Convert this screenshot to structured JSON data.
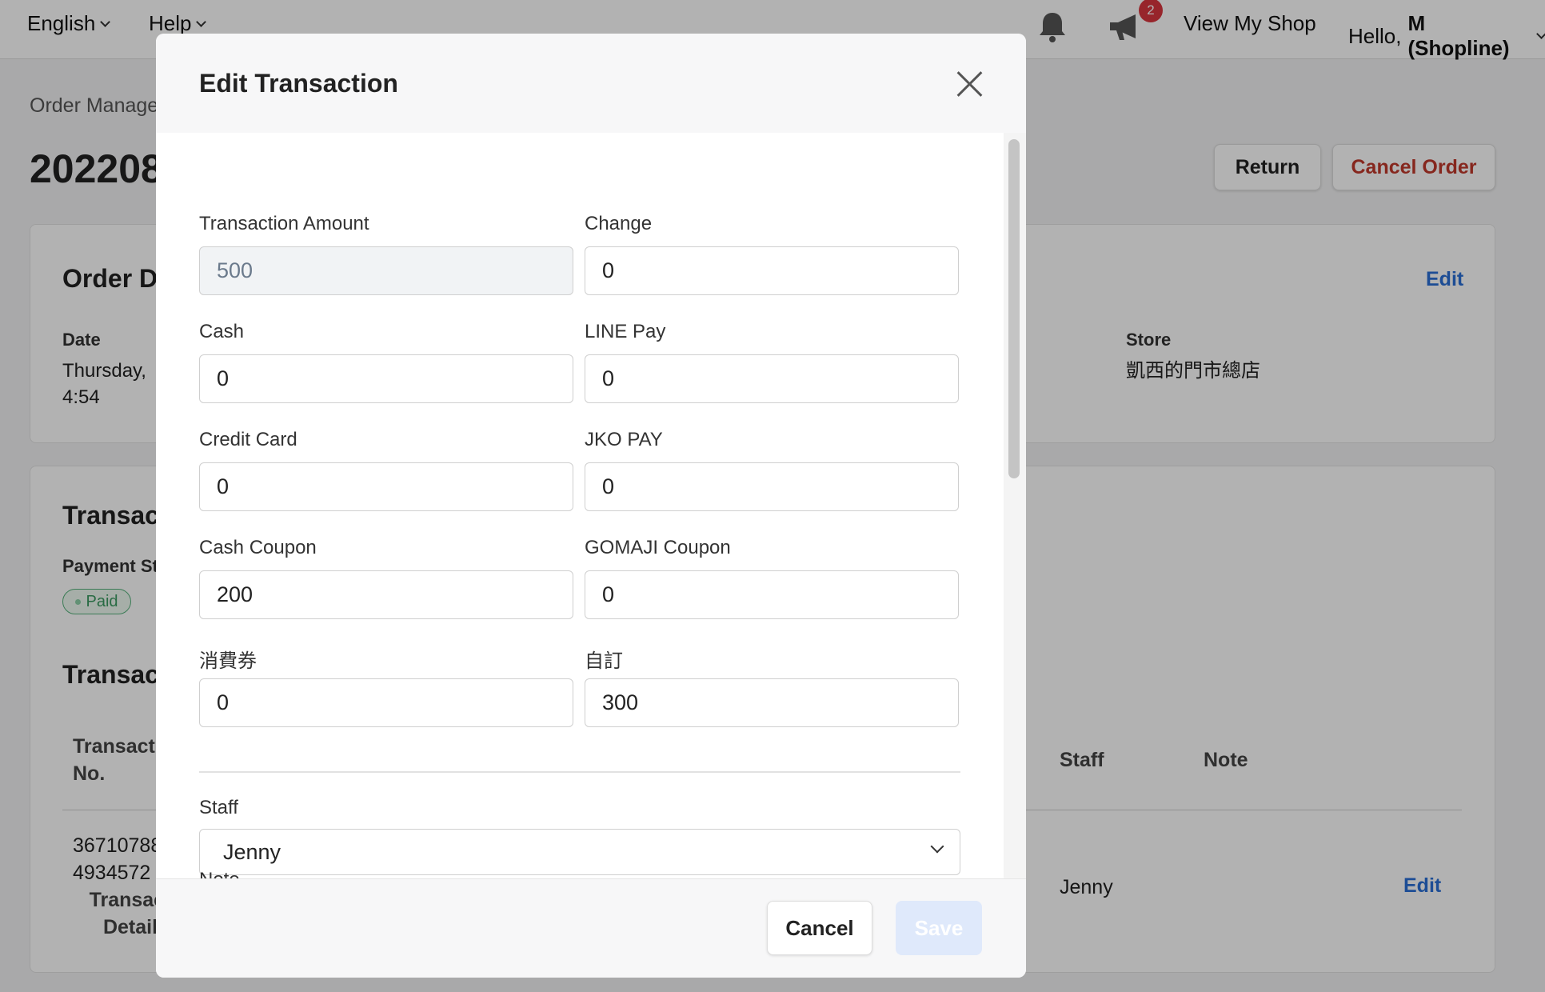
{
  "topbar": {
    "language": "English",
    "help": "Help",
    "notification_badge": "2",
    "view_shop": "View My Shop",
    "greeting": "Hello,",
    "user_name": "M (Shopline)"
  },
  "page": {
    "breadcrumb": "Order Manage",
    "order_no": "202208",
    "return_label": "Return",
    "cancel_order_label": "Cancel Order",
    "order_card": {
      "title": "Order De",
      "edit_label": "Edit",
      "date_label": "Date",
      "date_value_1": "Thursday,",
      "date_value_2": "4:54",
      "store_label": "Store",
      "store_value": "凱西的門市總店"
    },
    "transaction_card": {
      "title": "Transac",
      "payment_status_label": "Payment St",
      "payment_status": "Paid",
      "table_title": "Transac",
      "col_no_1": "Transact",
      "col_no_2": "No.",
      "col_staff": "Staff",
      "col_note": "Note",
      "row_no_1": "36710788",
      "row_no_2": "4934572",
      "row_detail_1": "Transact",
      "row_detail_2": "Detail",
      "row_staff": "Jenny",
      "row_edit": "Edit"
    }
  },
  "modal": {
    "title": "Edit Transaction",
    "fields": {
      "transaction_amount": {
        "label": "Transaction Amount",
        "value": "500"
      },
      "change": {
        "label": "Change",
        "value": "0"
      },
      "cash": {
        "label": "Cash",
        "value": "0"
      },
      "line_pay": {
        "label": "LINE Pay",
        "value": "0"
      },
      "credit_card": {
        "label": "Credit Card",
        "value": "0"
      },
      "jko_pay": {
        "label": "JKO PAY",
        "value": "0"
      },
      "cash_coupon": {
        "label": "Cash Coupon",
        "value": "200"
      },
      "gomaji_coupon": {
        "label": "GOMAJI Coupon",
        "value": "0"
      },
      "voucher": {
        "label": "消費券",
        "value": "0"
      },
      "custom": {
        "label": "自訂",
        "value": "300"
      }
    },
    "staff": {
      "label": "Staff",
      "value": "Jenny"
    },
    "note_label": "Note",
    "cancel_label": "Cancel",
    "save_label": "Save"
  }
}
